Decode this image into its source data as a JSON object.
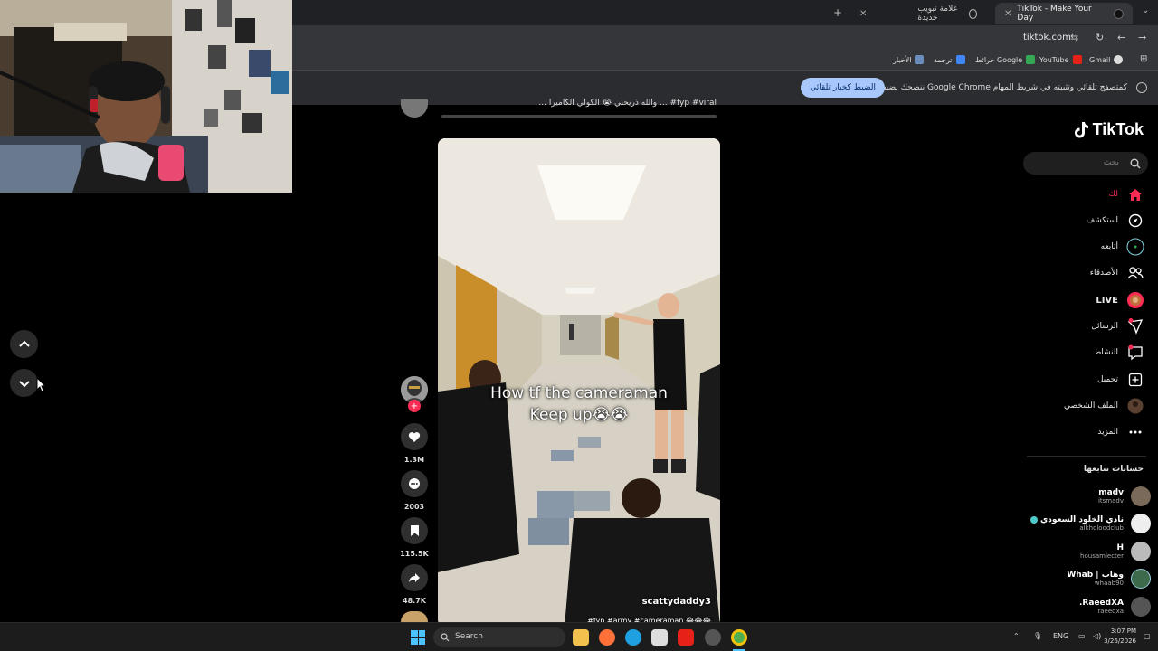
{
  "browser": {
    "tabs": [
      {
        "label": "TikTok - Make Your Day",
        "active": true
      },
      {
        "label": "علامة تبويب جديدة",
        "active": false
      }
    ],
    "url": "tiktok.com",
    "bookmarks": [
      "Gmail",
      "YouTube",
      "خرائط Google",
      "ترجمة",
      "الأخبار"
    ],
    "infobar": {
      "message": "ننصحك بضبط Google Chrome كمتصفح تلقائي وتثبيته في شريط المهام",
      "button": "الضبط كخيار تلقائي"
    }
  },
  "video": {
    "top_caption": "... والله ذريحني 😭 الكولي الكاميرا ... #fyp #viral",
    "caption_line1": "How tf the cameraman",
    "caption_line2": "Keep up😭😭",
    "author": "scattydaddy3",
    "hashtags": "#fyp #army #cameraman 😂😂😂"
  },
  "actions": {
    "likes": "1.3M",
    "comments": "2003",
    "saves": "115.5K",
    "shares": "48.7K"
  },
  "tiktok": {
    "logo": "TikTok",
    "search_placeholder": "بحث",
    "nav": [
      {
        "label": "لك",
        "icon": "home-icon"
      },
      {
        "label": "استكشف",
        "icon": "compass-icon"
      },
      {
        "label": "أتابعه",
        "icon": "following-icon"
      },
      {
        "label": "الأصدقاء",
        "icon": "friends-icon"
      },
      {
        "label": "LIVE",
        "icon": "live-icon"
      },
      {
        "label": "الرسائل",
        "icon": "messages-icon"
      },
      {
        "label": "النشاط",
        "icon": "activity-icon"
      },
      {
        "label": "تحميل",
        "icon": "upload-icon"
      },
      {
        "label": "الملف الشخصي",
        "icon": "profile-icon"
      },
      {
        "label": "المزيد",
        "icon": "more-icon"
      }
    ],
    "following_title": "حسابات تتابعها",
    "accounts": [
      {
        "name": "madv",
        "handle": "itsmadv"
      },
      {
        "name": "نادي الخلود السعودي",
        "handle": "alkholoodclub"
      },
      {
        "name": "H",
        "handle": "housamlecter"
      },
      {
        "name": "Whab | وهاب",
        "handle": "whaab90"
      },
      {
        "name": ".RaeedXA",
        "handle": "raeedxa"
      }
    ]
  },
  "taskbar": {
    "search": "Search",
    "lang": "ENG",
    "time": "3:07 PM",
    "date": "3/26/2026"
  },
  "colors": {
    "accent": "#fe2c55",
    "background": "#000000",
    "chrome_dark": "#202124"
  }
}
